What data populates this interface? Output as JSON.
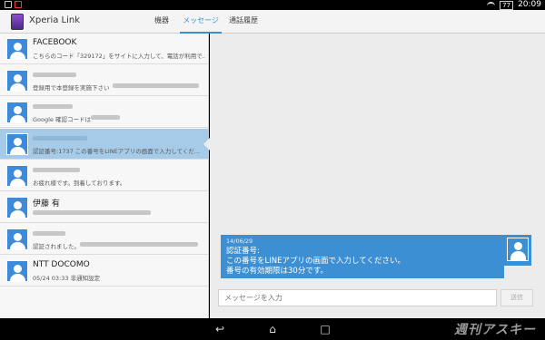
{
  "status_bar": {
    "battery": "77",
    "time": "20:09"
  },
  "app": {
    "title": "Xperia Link"
  },
  "tabs": [
    {
      "label": "機器"
    },
    {
      "label": "メッセージ"
    },
    {
      "label": "通話履歴"
    }
  ],
  "conversations": [
    {
      "name": "FACEBOOK",
      "preview": "こちらのコード「329172」をサイトに入力して、電話が利用で..."
    },
    {
      "name": "",
      "preview": "登録用で本登録を実施下さい"
    },
    {
      "name": "",
      "preview": "Google 確認コードは"
    },
    {
      "name": "",
      "preview": "認証番号:1737 この番号をLINEアプリの画面で入力してくだ..."
    },
    {
      "name": "",
      "preview": "お疲れ様です。到着しております。"
    },
    {
      "name": "伊藤 有",
      "preview": ""
    },
    {
      "name": "",
      "preview": "認証されました。"
    },
    {
      "name": "NTT DOCOMO",
      "preview": "05/24 03:33  非通知設定"
    }
  ],
  "message": {
    "date": "14/06/29",
    "line1": "認証番号:",
    "line2": "この番号をLINEアプリの画面で入力してください。",
    "line3": "番号の有効期限は30分です。"
  },
  "compose": {
    "placeholder": "メッセージを入力",
    "send_label": "送信"
  },
  "watermark": "週刊アスキー",
  "colors": {
    "accent": "#3b8fd2",
    "selected_row": "#a6cbe8"
  }
}
